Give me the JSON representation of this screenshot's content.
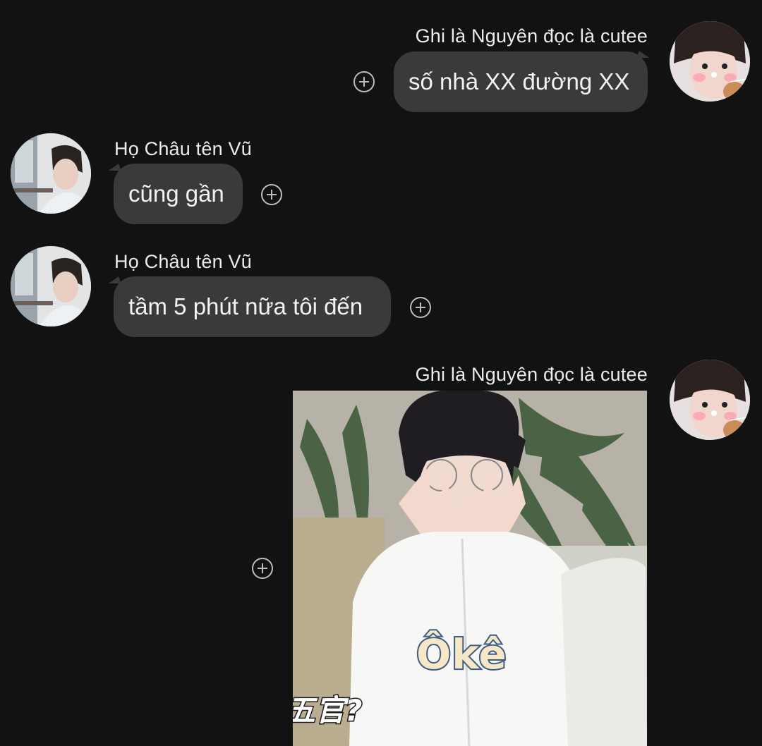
{
  "messages": [
    {
      "sender": "Ghi là Nguyên đọc là cutee",
      "text": "số nhà XX đường XX",
      "side": "right"
    },
    {
      "sender": "Họ Châu tên Vũ",
      "text": "cũng gần",
      "side": "left"
    },
    {
      "sender": "Họ Châu tên Vũ",
      "text": "tầm 5 phút nữa tôi đến",
      "side": "left"
    },
    {
      "sender": "Ghi là Nguyên đọc là cutee",
      "sticker": {
        "text": "Ôkê",
        "caption": "五官?"
      },
      "side": "right"
    }
  ],
  "icons": {
    "add_reaction": "plus-circle-icon"
  },
  "colors": {
    "background": "#121212",
    "bubble": "#3a3a3a",
    "text": "#f2f2f2"
  }
}
